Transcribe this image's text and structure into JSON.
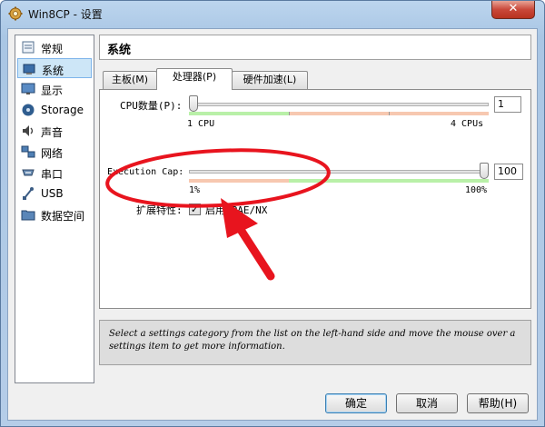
{
  "window": {
    "title": "Win8CP - 设置",
    "close_glyph": "✕"
  },
  "sidebar": {
    "items": [
      {
        "label": "常规",
        "icon": "general-icon"
      },
      {
        "label": "系统",
        "icon": "system-icon",
        "selected": true
      },
      {
        "label": "显示",
        "icon": "display-icon"
      },
      {
        "label": "Storage",
        "icon": "storage-icon"
      },
      {
        "label": "声音",
        "icon": "audio-icon"
      },
      {
        "label": "网络",
        "icon": "network-icon"
      },
      {
        "label": "串口",
        "icon": "serial-port-icon"
      },
      {
        "label": "USB",
        "icon": "usb-icon"
      },
      {
        "label": "数据空间",
        "icon": "shared-folder-icon"
      }
    ]
  },
  "header": {
    "title": "系统"
  },
  "tabs": [
    {
      "label": "主板(M)"
    },
    {
      "label": "处理器(P)",
      "active": true
    },
    {
      "label": "硬件加速(L)"
    }
  ],
  "processor": {
    "cpu_label": "CPU数量(P):",
    "cpu_value": "1",
    "cpu_min_label": "1  CPU",
    "cpu_max_label": "4  CPUs",
    "cpu_level": 0.0,
    "cap_label": "Execution Cap:",
    "cap_value": "100",
    "cap_min_label": "1%",
    "cap_max_label": "100%",
    "cap_level": 1.0,
    "ext_label": "扩展特性:",
    "pae_label": "启用 PAE/NX",
    "pae_checked": true,
    "check_glyph": "✓"
  },
  "info_text": "Select a settings category from the list on the left-hand side and move the mouse over a settings item to get more information.",
  "buttons": {
    "ok": "确定",
    "cancel": "取消",
    "help": "帮助(H)"
  },
  "colors": {
    "slider_ok": "#b9f0a8",
    "slider_warn": "#f7c8b0",
    "annotation": "#e8141e"
  }
}
